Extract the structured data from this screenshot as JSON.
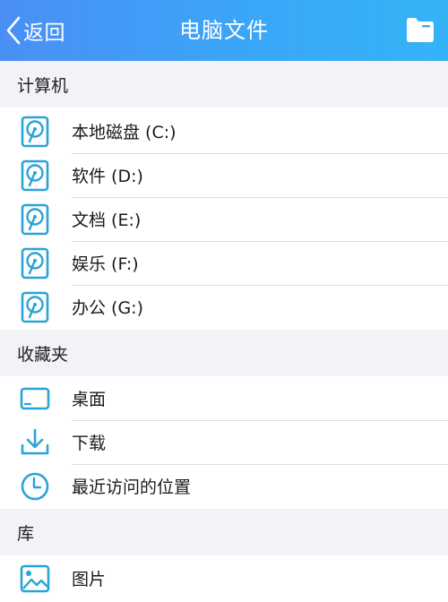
{
  "header": {
    "back_label": "返回",
    "title": "电脑文件"
  },
  "sections": {
    "computer": {
      "title": "计算机",
      "items": [
        {
          "label": "本地磁盘 (C:)",
          "icon": "hard-drive-icon"
        },
        {
          "label": "软件 (D:)",
          "icon": "hard-drive-icon"
        },
        {
          "label": "文档 (E:)",
          "icon": "hard-drive-icon"
        },
        {
          "label": "娱乐 (F:)",
          "icon": "hard-drive-icon"
        },
        {
          "label": "办公 (G:)",
          "icon": "hard-drive-icon"
        }
      ]
    },
    "favorites": {
      "title": "收藏夹",
      "items": [
        {
          "label": "桌面",
          "icon": "desktop-icon"
        },
        {
          "label": "下载",
          "icon": "download-icon"
        },
        {
          "label": "最近访问的位置",
          "icon": "recent-clock-icon"
        }
      ]
    },
    "library": {
      "title": "库",
      "items": [
        {
          "label": "图片",
          "icon": "image-icon"
        }
      ]
    }
  },
  "colors": {
    "accent": "#2aa3d8",
    "header_start": "#4a8ff5",
    "header_end": "#35b3f7",
    "section_bg": "#f2f2f7"
  }
}
